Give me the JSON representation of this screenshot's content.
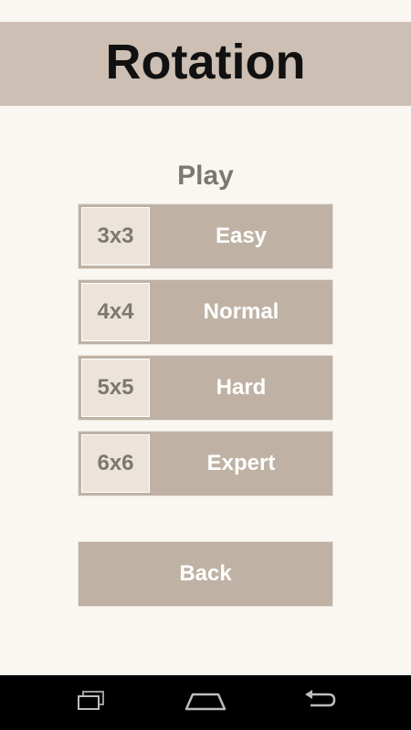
{
  "header": {
    "title": "Rotation"
  },
  "section": {
    "title": "Play"
  },
  "levels": [
    {
      "size": "3x3",
      "label": "Easy"
    },
    {
      "size": "4x4",
      "label": "Normal"
    },
    {
      "size": "5x5",
      "label": "Hard"
    },
    {
      "size": "6x6",
      "label": "Expert"
    }
  ],
  "back": {
    "label": "Back"
  },
  "nav": {
    "icons": [
      "recent-apps-icon",
      "home-icon",
      "back-arrow-icon"
    ]
  },
  "colors": {
    "background": "#faf7f2",
    "header": "#cdbfb3",
    "button": "#bfb2a5",
    "size_box": "#ece4da",
    "muted_text": "#7c7772",
    "nav_bar": "#000000"
  }
}
